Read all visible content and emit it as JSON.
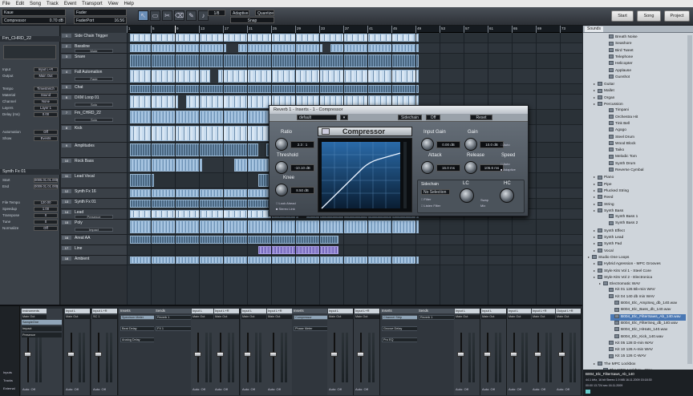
{
  "menu": [
    "File",
    "Edit",
    "Song",
    "Track",
    "Event",
    "Transport",
    "View",
    "Help"
  ],
  "toolbar": {
    "track_name": "Kaue",
    "track_sub": "Compressor",
    "track_vol": "0.70 dB",
    "fader_label": "Fader",
    "fader_sub": "FaderPort",
    "fader_val": "16.56",
    "snap_buttons": [
      "1/8",
      "Adaptive",
      "Quantize",
      "Snap"
    ],
    "nav_buttons": [
      "Start",
      "Song",
      "Project"
    ]
  },
  "inspector": {
    "track_title": "Fm_CHRD_22",
    "input_label": "Input",
    "input_value": "Input L+R",
    "output_label": "Output",
    "output_value": "Main Out",
    "params": [
      {
        "label": "Tempo",
        "value": "Timestretch"
      },
      {
        "label": "Material",
        "value": "Sound"
      },
      {
        "label": "Channel",
        "value": "None"
      },
      {
        "label": "Layers",
        "value": "Layer 1"
      },
      {
        "label": "Delay (ms)",
        "value": "0.00"
      }
    ],
    "automation_label": "Automation",
    "automation_value": "Off",
    "show_label": "Show",
    "show_value": "Events",
    "event_title": "Synth Fx 01",
    "event_params": [
      {
        "label": "Start",
        "value": "0005.01.01.000"
      },
      {
        "label": "End",
        "value": "0009.01.01.000"
      },
      {
        "label": "File Tempo",
        "value": "120.00"
      },
      {
        "label": "Speedup",
        "value": "1.00"
      },
      {
        "label": "Transpose",
        "value": "0"
      },
      {
        "label": "Tune",
        "value": "0"
      },
      {
        "label": "Normalize",
        "value": "Off"
      }
    ]
  },
  "tracks": [
    {
      "name": "Side Chain Trigger",
      "num": "1",
      "sub": ""
    },
    {
      "name": "Bassline",
      "num": "2",
      "sub": "Mute"
    },
    {
      "name": "Snare",
      "num": "3",
      "sub": ""
    },
    {
      "name": "Fall Automation",
      "num": "4",
      "sub": "Fade"
    },
    {
      "name": "Chat",
      "num": "5",
      "sub": ""
    },
    {
      "name": "DXM Loop 01",
      "num": "6",
      "sub": "Solo"
    },
    {
      "name": "Fm_CHRD_22",
      "num": "7",
      "sub": "Solo"
    },
    {
      "name": "Kick",
      "num": "8",
      "sub": ""
    },
    {
      "name": "Amplitudes",
      "num": "9",
      "sub": ""
    },
    {
      "name": "Rock Bass",
      "num": "10",
      "sub": ""
    },
    {
      "name": "Lead Vocal",
      "num": "11",
      "sub": ""
    },
    {
      "name": "Synth Fx 16",
      "num": "12",
      "sub": ""
    },
    {
      "name": "Synth Fx 01",
      "num": "13",
      "sub": ""
    },
    {
      "name": "Lead",
      "num": "14",
      "sub": "Presence"
    },
    {
      "name": "Poly",
      "num": "15",
      "sub": "Impact"
    },
    {
      "name": "Areal AA",
      "num": "16",
      "sub": ""
    },
    {
      "name": "Line",
      "num": "17",
      "sub": ""
    },
    {
      "name": "Ambient",
      "num": "18",
      "sub": ""
    }
  ],
  "ruler": [
    "1",
    "5",
    "9",
    "13",
    "17",
    "21",
    "25",
    "29",
    "33",
    "37",
    "41",
    "45",
    "49",
    "53",
    "57",
    "61",
    "65",
    "69",
    "73",
    "77"
  ],
  "compressor": {
    "title": "Reverb 1 - Inserts - 1 - Compressor",
    "preset": "default",
    "sidechain": "Sidechain",
    "off": "Off",
    "reset": "Reset",
    "name": "Compressor",
    "ratio_label": "Ratio",
    "ratio_value": "2.3 : 1",
    "threshold_label": "Threshold",
    "threshold_value": "-10.10 dB",
    "knee_label": "Knee",
    "knee_value": "8.50 dB",
    "look_ahead": "Look Ahead",
    "stereo_link": "Stereo Link",
    "input_gain_label": "Input Gain",
    "input_gain_value": "0.00 dB",
    "gain_label": "Gain",
    "gain_value": "10.0 dB",
    "auto": "Auto",
    "attack_label": "Attack",
    "attack_value": "16.0 ms",
    "release_label": "Release",
    "release_value": "105.6 ms",
    "speed_label": "Speed",
    "adaptive": "Adaptive",
    "sidechain_label": "Sidechain",
    "sidechain_source": "No Selection",
    "filter": "Filter",
    "listen_filter": "Listen Filter",
    "lc_label": "LC",
    "hc_label": "HC",
    "swap_label": "Swap",
    "swap_mode": "Mix"
  },
  "browser": {
    "tabs": [
      "Sounds"
    ],
    "items": [
      {
        "label": "Breath Noise",
        "indent": 3
      },
      {
        "label": "Seashore",
        "indent": 3
      },
      {
        "label": "Bird Tweet",
        "indent": 3
      },
      {
        "label": "Telephone",
        "indent": 3
      },
      {
        "label": "Helicopter",
        "indent": 3
      },
      {
        "label": "Applause",
        "indent": 3
      },
      {
        "label": "Gunshot",
        "indent": 3
      },
      {
        "label": "Guitar",
        "indent": 1
      },
      {
        "label": "Mallet",
        "indent": 1
      },
      {
        "label": "Organ",
        "indent": 1
      },
      {
        "label": "Percussion",
        "indent": 1
      },
      {
        "label": "Timpani",
        "indent": 3
      },
      {
        "label": "Orchestra Hit",
        "indent": 3
      },
      {
        "label": "Tink Bell",
        "indent": 3
      },
      {
        "label": "Agogo",
        "indent": 3
      },
      {
        "label": "Steel Drum",
        "indent": 3
      },
      {
        "label": "Wood Block",
        "indent": 3
      },
      {
        "label": "Taiko",
        "indent": 3
      },
      {
        "label": "Melodic Tom",
        "indent": 3
      },
      {
        "label": "Synth Drum",
        "indent": 3
      },
      {
        "label": "Reverse Cymbal",
        "indent": 3
      },
      {
        "label": "Piano",
        "indent": 1
      },
      {
        "label": "Pipe",
        "indent": 1
      },
      {
        "label": "Plucked String",
        "indent": 1
      },
      {
        "label": "Reed",
        "indent": 1
      },
      {
        "label": "String",
        "indent": 1
      },
      {
        "label": "Synth Bass",
        "indent": 1
      },
      {
        "label": "Synth Bass 1",
        "indent": 3
      },
      {
        "label": "Synth Bass 2",
        "indent": 3
      },
      {
        "label": "Synth Effect",
        "indent": 1
      },
      {
        "label": "Synth Lead",
        "indent": 1
      },
      {
        "label": "Synth Pad",
        "indent": 1
      },
      {
        "label": "Vocal",
        "indent": 1
      },
      {
        "label": "Studio One Loops",
        "indent": 0
      },
      {
        "label": "Hybrid Agression - MPC Grooves",
        "indent": 1
      },
      {
        "label": "Style Kits Vol 1 - Steel Core",
        "indent": 1
      },
      {
        "label": "Style Kits Vol 2 - Electronica",
        "indent": 1
      },
      {
        "label": "Electromatic WAV",
        "indent": 2
      },
      {
        "label": "Kit 01 126 Bb-min WAV",
        "indent": 3
      },
      {
        "label": "Kit 04 140 db min WAV",
        "indent": 3
      },
      {
        "label": "B004_Elc_AmpSeq_db_140.wav",
        "indent": 4
      },
      {
        "label": "B004_Elc_Bass_db_140.wav",
        "indent": 4
      },
      {
        "label": "B004_Elc_FilterSaws_Ab_140.wav",
        "indent": 4
      },
      {
        "label": "B004_Elc_FilterSeq_db_140.wav",
        "indent": 4
      },
      {
        "label": "B004_Elc_HiHats_140.wav",
        "indent": 4
      },
      {
        "label": "B004_Elc_Kick_140.wav",
        "indent": 4
      },
      {
        "label": "Kit 05 128 D-min WAV",
        "indent": 3
      },
      {
        "label": "Kit 10 126 A-min WAV",
        "indent": 3
      },
      {
        "label": "Kit 15 126 C-WAV",
        "indent": 3
      },
      {
        "label": "The MPC Lockbox",
        "indent": 1
      },
      {
        "label": "The MPC Lockbox - Wav",
        "indent": 2
      }
    ],
    "selected_index": 42,
    "footer_file": "B004_Elc_FilterSaws_Ab_140",
    "footer_info": "44.1 kHz, 16 bit Stereo   1.9 MB   16.11.2009 15:18:30",
    "footer_time": "00:00   13.724 sec   16.11.2009"
  },
  "mixer": {
    "side_labels": [
      "Inputs",
      "Tracks",
      "External"
    ],
    "strips_a": [
      {
        "name": "Instruments",
        "io": "Main Out"
      },
      {
        "name": "Input L",
        "io": "Main Out"
      },
      {
        "name": "Input L+R",
        "io": "SC 1"
      }
    ],
    "insert_panels": [
      {
        "title": "Inserts",
        "rows": [
          "SampleOne",
          "Impact",
          "Presence"
        ],
        "hl": 0
      },
      {
        "title": "Inserts",
        "rows": [
          "Spectrum Meter",
          "Beat Delay",
          "Analog Delay"
        ],
        "hl": 0
      },
      {
        "title": "Sends",
        "rows": [
          "Reverb 1",
          "FX 1"
        ],
        "hl": -1
      },
      {
        "title": "Inserts",
        "rows": [
          "Compressor",
          "Phase Meter"
        ],
        "hl": 0
      },
      {
        "title": "Inserts",
        "rows": [
          "Channel Strip",
          "Groove Delay",
          "Pro EQ"
        ],
        "hl": 0
      },
      {
        "title": "Sends",
        "rows": [
          "Reverb 1"
        ],
        "hl": -1
      }
    ],
    "strips_b": [
      {
        "name": "Input L",
        "io": "Main Out"
      },
      {
        "name": "Input L+R",
        "io": "Main Out"
      },
      {
        "name": "Input L",
        "io": "Main Out"
      },
      {
        "name": "Input L+R",
        "io": "Main Out"
      },
      {
        "name": "Input L",
        "io": "Main Out"
      },
      {
        "name": "Input L+R",
        "io": "Main Out"
      },
      {
        "name": "Input L",
        "io": "Main Out"
      },
      {
        "name": "Input L",
        "io": "Main Out"
      },
      {
        "name": "Input L",
        "io": "Main Out"
      },
      {
        "name": "Input L+R",
        "io": "Main Out"
      },
      {
        "name": "Input L+R",
        "io": "Main Out"
      },
      {
        "name": "Output L+R",
        "io": "Main Out"
      }
    ],
    "auto_label": "Auto: Off"
  }
}
